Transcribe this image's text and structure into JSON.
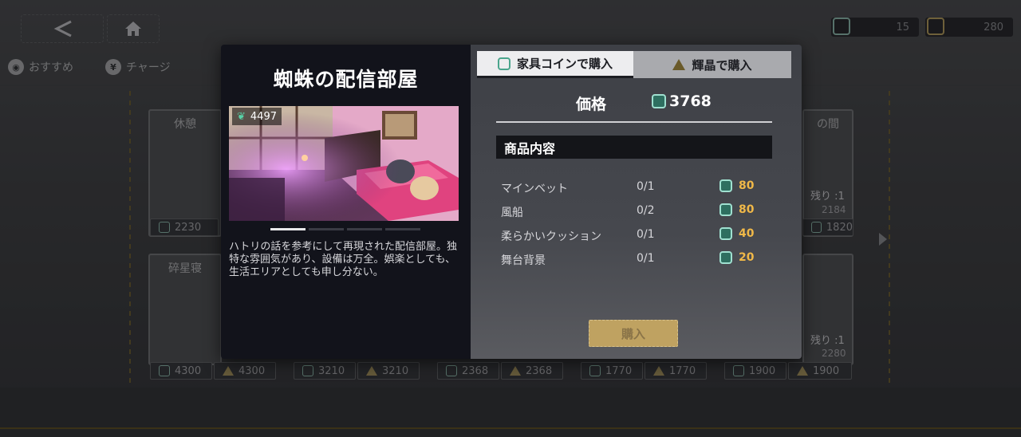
{
  "header": {
    "furniture_coins": "15",
    "crystals": "280"
  },
  "shop_tabs": [
    {
      "label": "おすすめ"
    },
    {
      "label": "チャージ"
    }
  ],
  "background_cards": [
    {
      "title": "休憩",
      "price": "2230"
    },
    {
      "title": "碎星寝",
      "price_coin": "4300",
      "price_crystal": "4300"
    },
    {
      "price_coin": "3210",
      "price_crystal": "3210"
    },
    {
      "price_coin": "2368",
      "price_crystal": "2368"
    },
    {
      "price_coin": "1770",
      "price_crystal": "1770"
    },
    {
      "title": "の間",
      "remaining": "残り :1",
      "likes": "2184",
      "price": "1820"
    },
    {
      "remaining": "残り :1",
      "likes": "2280",
      "price_coin": "1900",
      "price_crystal": "1900"
    }
  ],
  "modal": {
    "title": "蜘蛛の配信部屋",
    "likes": "4497",
    "description": "ハトリの話を参考にして再現された配信部屋。独特な雰囲気があり、設備は万全。娯楽としても、生活エリアとしても申し分ない。",
    "tabs": {
      "coin": "家具コインで購入",
      "crystal": "輝晶で購入"
    },
    "price_label": "価格",
    "price_value": "3768",
    "section_title": "商品内容",
    "items": [
      {
        "name": "マインベット",
        "qty": "0/1",
        "cost": "80"
      },
      {
        "name": "風船",
        "qty": "0/2",
        "cost": "80"
      },
      {
        "name": "柔らかいクッション",
        "qty": "0/1",
        "cost": "40"
      },
      {
        "name": "舞台背景",
        "qty": "0/1",
        "cost": "20"
      }
    ],
    "buy_label": "購入"
  },
  "colors": {
    "accent_gold": "#f0b848",
    "coin_teal": "#57d3a7",
    "buy_button": "#bfa261"
  }
}
